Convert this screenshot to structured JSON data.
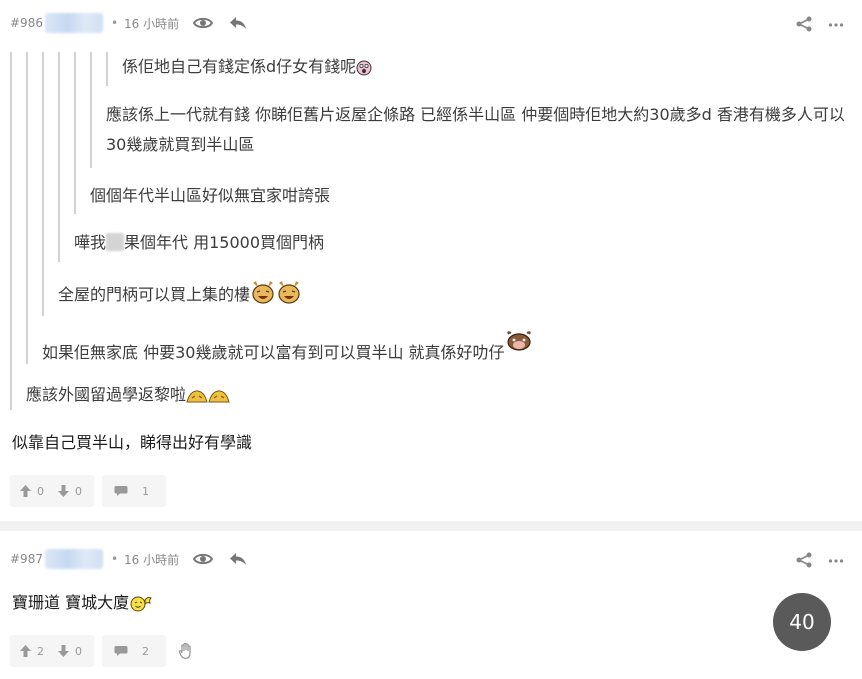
{
  "posts": [
    {
      "number": "#986",
      "separator": "•",
      "time": "16 小時前",
      "quotes": [
        {
          "level": 6,
          "text": "係佢地自己有錢定係d仔女有錢呢"
        },
        {
          "level": 5,
          "text": "應該係上一代就有錢 你睇佢舊片返屋企條路 已經係半山區 仲要個時佢地大約30歲多d 香港有機多人可以30幾歲就買到半山區"
        },
        {
          "level": 4,
          "text": "個個年代半山區好似無宜家咁誇張"
        },
        {
          "level": 3,
          "text_before": "嘩我",
          "text_after": "果個年代 用15000買個門柄"
        },
        {
          "level": 2,
          "text": "全屋的門柄可以買上集的樓"
        },
        {
          "level": 1,
          "text": "如果佢無家底 仲要30幾歲就可以富有到可以買半山 就真係好叻仔"
        },
        {
          "level": 0,
          "text": "應該外國留過學返黎啦"
        }
      ],
      "content": "似靠自己買半山，睇得出好有學識",
      "likes": "0",
      "dislikes": "0",
      "replies": "1"
    },
    {
      "number": "#987",
      "separator": "•",
      "time": "16 小時前",
      "content": "寶珊道 寶城大廈",
      "likes": "2",
      "dislikes": "0",
      "replies": "2"
    }
  ],
  "page_badge": "40",
  "icons": {
    "view": "eye-icon",
    "reply": "reply-icon",
    "share": "share-icon",
    "more": "more-icon",
    "like": "thumb-up-icon",
    "dislike": "thumb-down-icon",
    "comments": "comment-icon",
    "block": "hand-icon"
  },
  "colors": {
    "meta_text": "#888888",
    "quote_line": "#d3d3d3",
    "badge": "#5a5a5a",
    "separator": "#f1f1f1"
  }
}
